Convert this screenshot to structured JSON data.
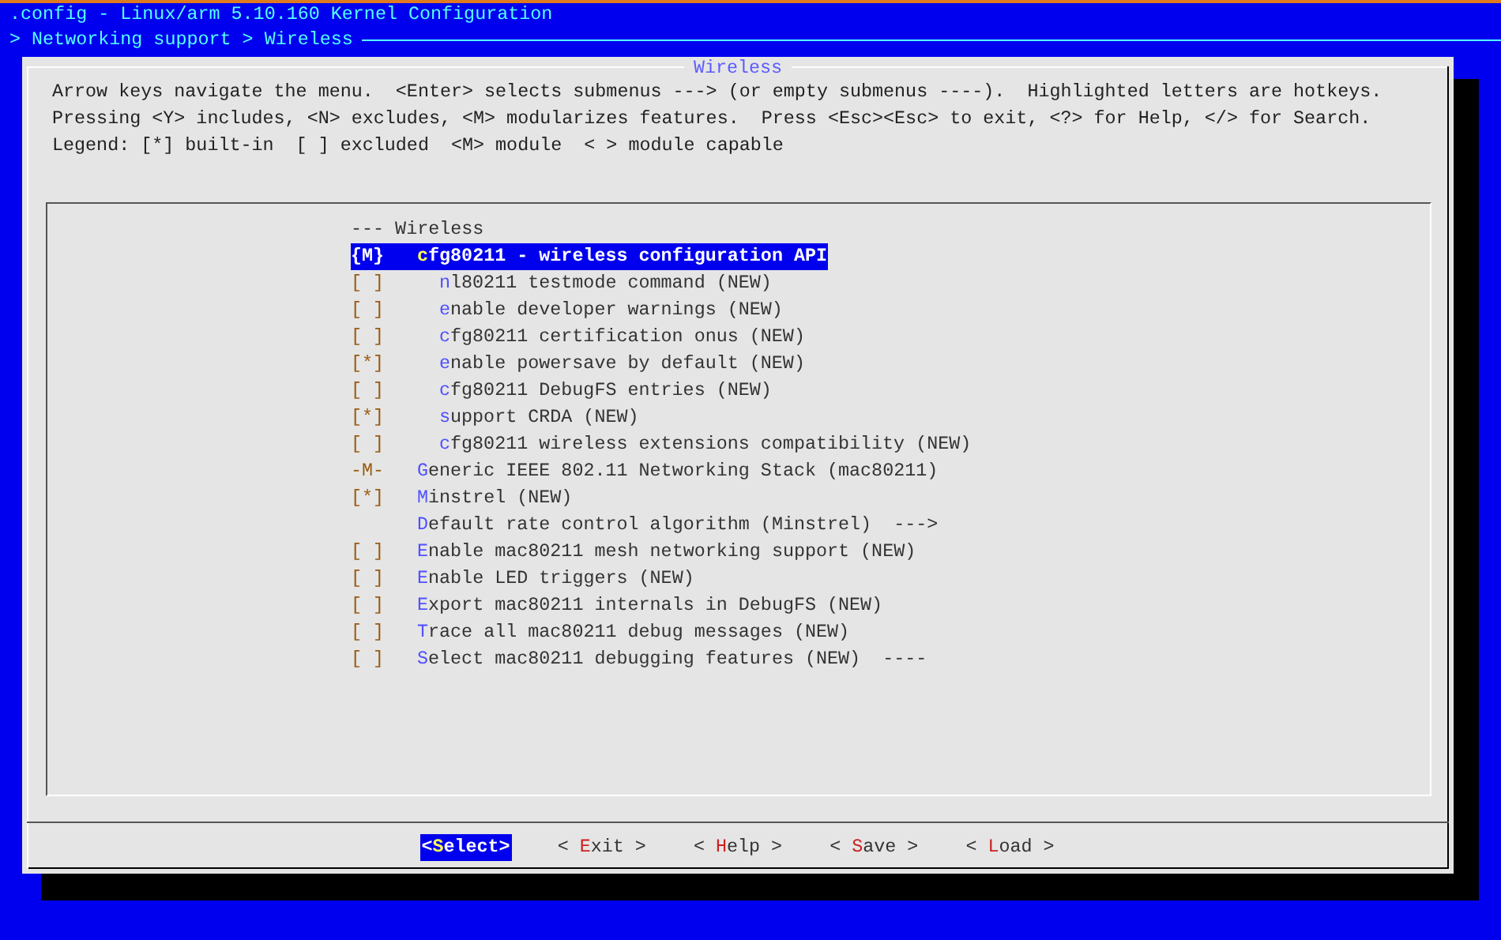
{
  "window": {
    "title": ".config - Linux/arm 5.10.160 Kernel Configuration",
    "breadcrumb": "> Networking support > Wireless"
  },
  "dialog": {
    "title": "Wireless",
    "help_lines": [
      "Arrow keys navigate the menu.  <Enter> selects submenus ---> (or empty submenus ----).  Highlighted letters are hotkeys.",
      "Pressing <Y> includes, <N> excludes, <M> modularizes features.  Press <Esc><Esc> to exit, <?> for Help, </> for Search.",
      "Legend: [*] built-in  [ ] excluded  <M> module  < > module capable"
    ],
    "menu": [
      {
        "kind": "header",
        "text": "--- Wireless"
      },
      {
        "kind": "option",
        "indicator": "{M}",
        "hotkey": "c",
        "rest": "fg80211 - wireless configuration API",
        "selected": true,
        "children": [
          {
            "kind": "option",
            "indicator": "[ ]",
            "hotkey": "n",
            "rest": "l80211 testmode command (NEW)",
            "selected": false
          },
          {
            "kind": "option",
            "indicator": "[ ]",
            "hotkey": "e",
            "rest": "nable developer warnings (NEW)",
            "selected": false
          },
          {
            "kind": "option",
            "indicator": "[ ]",
            "hotkey": "c",
            "rest": "fg80211 certification onus (NEW)",
            "selected": false
          },
          {
            "kind": "option",
            "indicator": "[*]",
            "hotkey": "e",
            "rest": "nable powersave by default (NEW)",
            "selected": false
          },
          {
            "kind": "option",
            "indicator": "[ ]",
            "hotkey": "c",
            "rest": "fg80211 DebugFS entries (NEW)",
            "selected": false
          },
          {
            "kind": "option",
            "indicator": "[*]",
            "hotkey": "s",
            "rest": "upport CRDA (NEW)",
            "selected": false
          },
          {
            "kind": "option",
            "indicator": "[ ]",
            "hotkey": "c",
            "rest": "fg80211 wireless extensions compatibility (NEW)",
            "selected": false
          }
        ]
      },
      {
        "kind": "option",
        "indicator": "-M-",
        "hotkey": "G",
        "rest": "eneric IEEE 802.11 Networking Stack (mac80211)",
        "selected": false
      },
      {
        "kind": "option",
        "indicator": "[*]",
        "hotkey": "M",
        "rest": "instrel (NEW)",
        "selected": false
      },
      {
        "kind": "option",
        "hotkey": "D",
        "rest": "efault rate control algorithm (Minstrel)  --->",
        "selected": false
      },
      {
        "kind": "option",
        "indicator": "[ ]",
        "hotkey": "E",
        "rest": "nable mac80211 mesh networking support (NEW)",
        "selected": false
      },
      {
        "kind": "option",
        "indicator": "[ ]",
        "hotkey": "E",
        "rest": "nable LED triggers (NEW)",
        "selected": false
      },
      {
        "kind": "option",
        "indicator": "[ ]",
        "hotkey": "E",
        "rest": "xport mac80211 internals in DebugFS (NEW)",
        "selected": false
      },
      {
        "kind": "option",
        "indicator": "[ ]",
        "hotkey": "T",
        "rest": "race all mac80211 debug messages (NEW)",
        "selected": false
      },
      {
        "kind": "option",
        "indicator": "[ ]",
        "hotkey": "S",
        "rest": "elect mac80211 debugging features (NEW)  ----",
        "selected": false
      }
    ],
    "buttons": [
      {
        "left": "<",
        "hotkey": "S",
        "rest": "elect",
        "right": ">",
        "selected": true
      },
      {
        "left": "< ",
        "hotkey": "E",
        "rest": "xit",
        "right": " >",
        "selected": false
      },
      {
        "left": "< ",
        "hotkey": "H",
        "rest": "elp",
        "right": " >",
        "selected": false
      },
      {
        "left": "< ",
        "hotkey": "S",
        "rest": "ave",
        "right": " >",
        "selected": false
      },
      {
        "left": "< ",
        "hotkey": "L",
        "rest": "oad",
        "right": " >",
        "selected": false
      }
    ]
  }
}
